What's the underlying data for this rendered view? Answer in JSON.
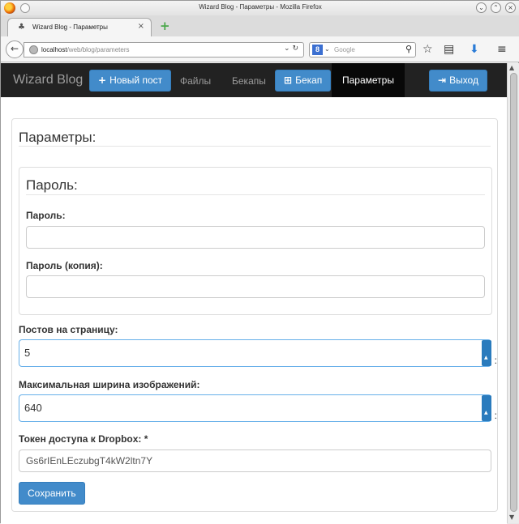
{
  "window": {
    "title": "Wizard Blog - Параметры - Mozilla Firefox"
  },
  "browser": {
    "tab_title": "Wizard Blog - Параметры",
    "url_host": "localhost",
    "url_path": "/web/blog/parameters",
    "search_placeholder": "Google"
  },
  "navbar": {
    "brand": "Wizard Blog",
    "new_post": "Новый пост",
    "files": "Файлы",
    "backups": "Бекапы",
    "backup": "Бекап",
    "parameters": "Параметры",
    "logout": "Выход"
  },
  "panel": {
    "title": "Параметры:",
    "password_section": {
      "title": "Пароль:",
      "password_label": "Пароль:",
      "password_value": "",
      "password_copy_label": "Пароль (копия):",
      "password_copy_value": ""
    },
    "posts_per_page_label": "Постов на страницу:",
    "posts_per_page_value": "5",
    "max_image_width_label": "Максимальная ширина изображений:",
    "max_image_width_value": "640",
    "dropbox_token_label": "Токен доступа к Dropbox: *",
    "dropbox_token_value": "Gs6rIEnLEczubgT4kW2ltn7Y",
    "save_button": "Сохранить"
  },
  "colors": {
    "navbar_bg": "#222222",
    "primary": "#428bca",
    "active_nav_bg": "#080808"
  }
}
